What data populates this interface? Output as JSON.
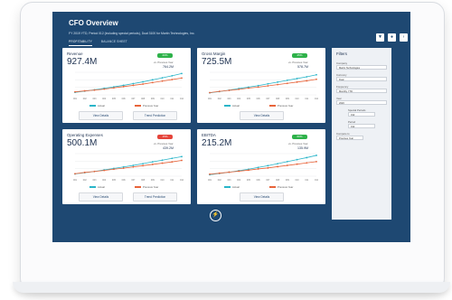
{
  "app": {
    "title": "CFO Overview",
    "subtitle": "FY 2019 YTD, Period 012 (including special periods), Dual 3100 for Martin Technologies, Inc."
  },
  "tabs": [
    {
      "label": "PROFITABILITY",
      "active": true
    },
    {
      "label": "BALANCE SHEET",
      "active": false
    }
  ],
  "header_buttons": [
    {
      "icon": "filter-icon"
    },
    {
      "icon": "settings-icon"
    },
    {
      "icon": "chevron-right-icon"
    }
  ],
  "panels": [
    {
      "title": "Revenue",
      "value": "927.4M",
      "badge": "20%",
      "badge_trend": "up",
      "prev_label": "vs. Previous Year",
      "prev_value": "764.2M",
      "legend": [
        "Actual",
        "Previous Year"
      ],
      "buttons": [
        "View Details",
        "Trend Prediction"
      ]
    },
    {
      "title": "Gross Margin",
      "value": "725.5M",
      "badge": "25%",
      "badge_trend": "up",
      "prev_label": "vs. Previous Year",
      "prev_value": "578.7M",
      "legend": [
        "Actual",
        "Previous Year"
      ],
      "buttons": [
        "View Details"
      ]
    },
    {
      "title": "Operating Expenses",
      "value": "500.1M",
      "badge": "15%",
      "badge_trend": "down",
      "prev_label": "vs. Previous Year",
      "prev_value": "439.2M",
      "legend": [
        "Actual",
        "Previous Year"
      ],
      "buttons": [
        "View Details",
        "Trend Prediction"
      ]
    },
    {
      "title": "EBITDA",
      "value": "215.2M",
      "badge": "60%",
      "badge_trend": "up",
      "prev_label": "vs. Previous Year",
      "prev_value": "135.9M",
      "legend": [
        "Actual",
        "Previous Year"
      ],
      "buttons": [
        "View Details"
      ]
    }
  ],
  "filters": {
    "title": "Filters",
    "fields": [
      {
        "label": "Company",
        "value": "Martin Technologies"
      },
      {
        "label": "Currency",
        "value": "Dual"
      },
      {
        "label": "Frequency",
        "value": "Monthly YTD"
      },
      {
        "label": "Year",
        "value": "2020"
      },
      {
        "label": "Special Periods",
        "value": "012"
      },
      {
        "label": "Period",
        "value": "012"
      },
      {
        "label": "Compare to",
        "value": "Previous Year"
      }
    ]
  },
  "colors": {
    "screen_bg": "#1e4872",
    "actual": "#29b5c9",
    "previous_year": "#e8643a",
    "badge_up": "#2eb24a",
    "badge_down": "#e5443a"
  },
  "chart_data": [
    {
      "type": "line",
      "panel": "Revenue",
      "categories": [
        "001",
        "002",
        "003",
        "004",
        "005",
        "006",
        "007",
        "008",
        "009",
        "010",
        "011",
        "012"
      ],
      "series": [
        {
          "name": "Actual",
          "values": [
            10,
            15,
            20,
            26,
            32,
            38,
            45,
            52,
            60,
            68,
            76,
            85
          ]
        },
        {
          "name": "Previous Year",
          "values": [
            12,
            16,
            19,
            23,
            28,
            33,
            38,
            43,
            49,
            55,
            61,
            67
          ]
        }
      ]
    },
    {
      "type": "line",
      "panel": "Gross Margin",
      "categories": [
        "001",
        "002",
        "003",
        "004",
        "005",
        "006",
        "007",
        "008",
        "009",
        "010",
        "011",
        "012"
      ],
      "series": [
        {
          "name": "Actual",
          "values": [
            8,
            13,
            19,
            25,
            31,
            37,
            44,
            51,
            58,
            65,
            72,
            80
          ]
        },
        {
          "name": "Previous Year",
          "values": [
            9,
            14,
            18,
            22,
            27,
            31,
            36,
            41,
            46,
            51,
            56,
            62
          ]
        }
      ]
    },
    {
      "type": "line",
      "panel": "Operating Expenses",
      "categories": [
        "001",
        "002",
        "003",
        "004",
        "005",
        "006",
        "007",
        "008",
        "009",
        "010",
        "011",
        "012"
      ],
      "series": [
        {
          "name": "Actual",
          "values": [
            9,
            14,
            19,
            25,
            31,
            37,
            43,
            50,
            57,
            64,
            71,
            78
          ]
        },
        {
          "name": "Previous Year",
          "values": [
            10,
            15,
            19,
            23,
            28,
            32,
            37,
            42,
            47,
            52,
            57,
            63
          ]
        }
      ]
    },
    {
      "type": "line",
      "panel": "EBITDA",
      "categories": [
        "001",
        "002",
        "003",
        "004",
        "005",
        "006",
        "007",
        "008",
        "009",
        "010",
        "011",
        "012"
      ],
      "series": [
        {
          "name": "Actual",
          "values": [
            6,
            11,
            16,
            22,
            28,
            35,
            42,
            50,
            58,
            66,
            74,
            83
          ]
        },
        {
          "name": "Previous Year",
          "values": [
            8,
            12,
            16,
            20,
            24,
            29,
            33,
            38,
            43,
            48,
            53,
            58
          ]
        }
      ]
    }
  ]
}
